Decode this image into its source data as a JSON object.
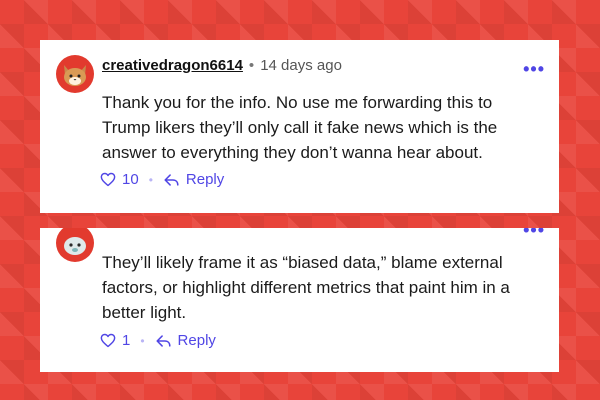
{
  "comments": [
    {
      "username": "creativedragon6614",
      "separator": "•",
      "time": "14 days ago",
      "more": "•••",
      "text": "Thank you for the info. No use me forwarding this to Trump likers they’ll only call it fake news which is the answer to everything they don’t wanna hear about.",
      "likes": "10",
      "action_sep": "•",
      "reply_label": "Reply",
      "avatar_icon": "cat-face-icon"
    },
    {
      "username": "",
      "time": "",
      "more": "•••",
      "text": "They’ll likely frame it as “biased data,” blame external factors, or highlight different metrics that paint him in a better light.",
      "likes": "1",
      "action_sep": "•",
      "reply_label": "Reply",
      "avatar_icon": "animal-face-icon"
    }
  ],
  "colors": {
    "background": "#e8443a",
    "accent": "#5046e5",
    "avatar": "#e23a2e"
  }
}
